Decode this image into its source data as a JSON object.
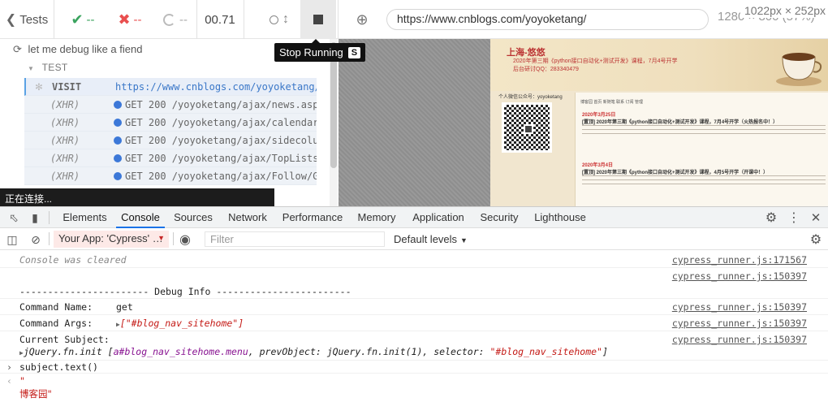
{
  "topbar": {
    "back_label": "Tests",
    "passed": "--",
    "failed": "--",
    "pending": "--",
    "duration": "00.71",
    "url": "https://www.cnblogs.com/yoyoketang/",
    "viewport": "1280 × 800 (57%)",
    "dims_overlay": "1022px × 252px"
  },
  "tooltip": {
    "label": "Stop Running",
    "key": "S"
  },
  "reporter": {
    "spec_title": "let me debug like a fiend",
    "test_title": "TEST",
    "commands": [
      {
        "name": "VISIT",
        "msg": "https://www.cnblogs.com/yoyoketang/"
      },
      {
        "name": "(XHR)",
        "msg": "GET 200 /yoyoketang/ajax/news.aspx"
      },
      {
        "name": "(XHR)",
        "msg": "GET 200 /yoyoketang/ajax/calendar…"
      },
      {
        "name": "(XHR)",
        "msg": "GET 200 /yoyoketang/ajax/sidecolu…"
      },
      {
        "name": "(XHR)",
        "msg": "GET 200 /yoyoketang/ajax/TopLists…"
      },
      {
        "name": "(XHR)",
        "msg": "GET 200 /yoyoketang/ajax/Follow/G…"
      }
    ],
    "status_popup": "正在连接..."
  },
  "aut": {
    "site_title": "上海-悠悠",
    "line1": "2020年第三期《python接口自动化+测试开发》课程，7月4号开学",
    "line2": "后台研讨QQ：283340479",
    "wechat_label": "个人微信公众号：yoyoketang",
    "nav": "博客园   首页   新随笔   联系   订阅   管理",
    "date1": "2020年3月25日",
    "post1": "[置顶] 2020年第三期《python接口自动化+测试开发》课程，7月4号开学（火热报名中！）",
    "date2": "2020年3月4日",
    "post2": "[置顶] 2020年第三期《python接口自动化+测试开发》课程，4月5号开学（开课中！）"
  },
  "devtools": {
    "tabs": [
      "Elements",
      "Console",
      "Sources",
      "Network",
      "Performance",
      "Memory",
      "Application",
      "Security",
      "Lighthouse"
    ],
    "active_tab": "Console",
    "context": "Your App: 'Cypress' …",
    "filter_placeholder": "Filter",
    "levels": "Default levels"
  },
  "console": {
    "cleared": "Console was cleared",
    "src1": "cypress_runner.js:171567",
    "src2": "cypress_runner.js:150397",
    "debug_header": "----------------------- Debug Info ------------------------",
    "cmd_name_label": "Command Name:",
    "cmd_name_val": "get",
    "cmd_args_label": "Command Args:",
    "cmd_args_val": "[\"#blog_nav_sitehome\"]",
    "subject_label": "Current Subject:",
    "subject_prefix": "jQuery.fn.init [",
    "subject_el": "a#blog_nav_sitehome.menu",
    "subject_mid": ", prevObject: jQuery.fn.init(1), selector: ",
    "subject_sel": "\"#blog_nav_sitehome\"",
    "subject_end": "]",
    "input": "subject.text()",
    "result_open": "\"",
    "result_val": "博客园\""
  }
}
